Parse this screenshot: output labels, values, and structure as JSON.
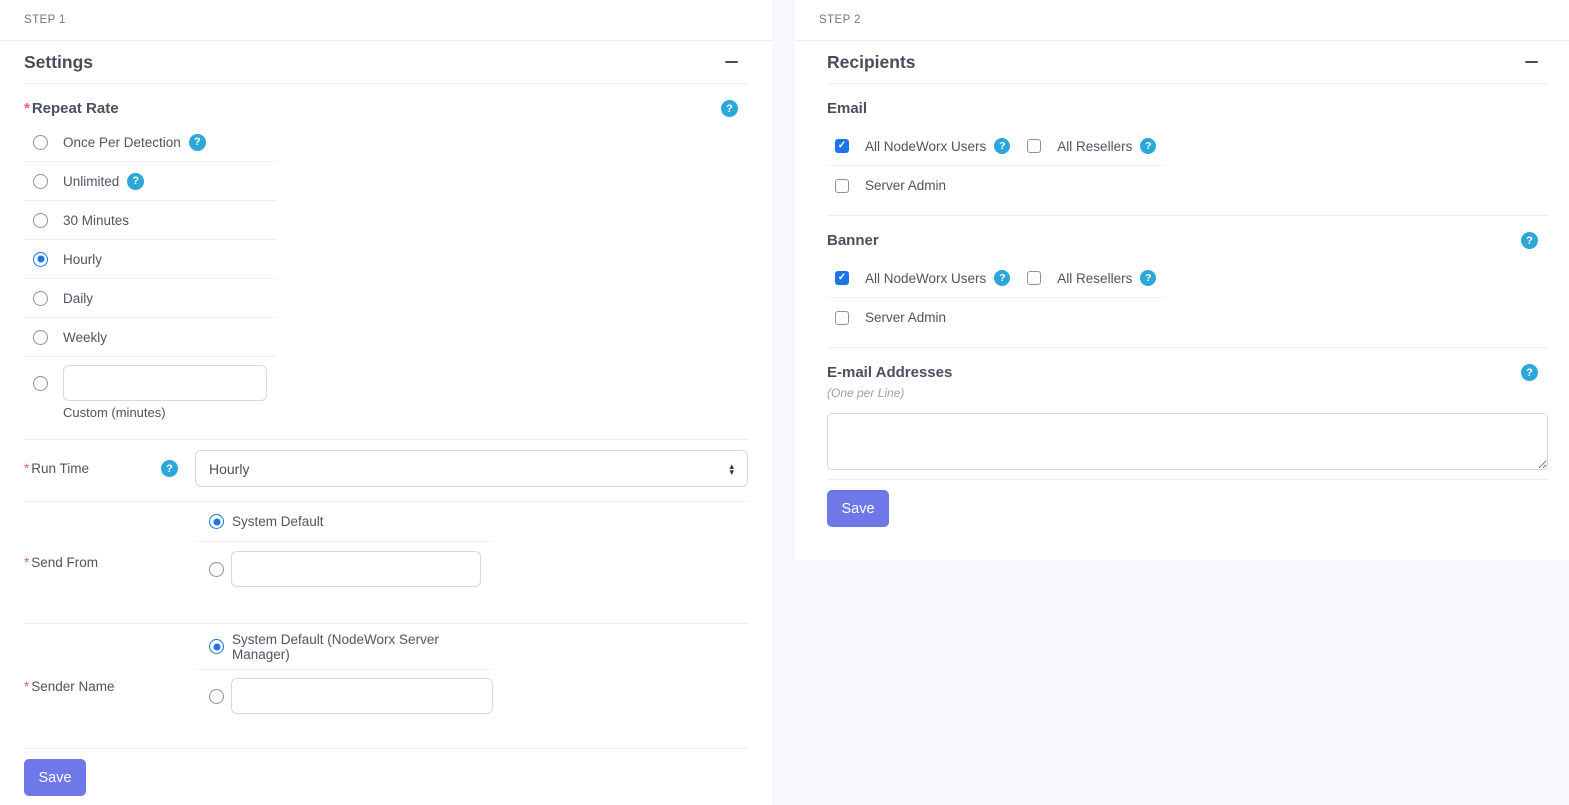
{
  "icons": {
    "help": "?",
    "check": "✓",
    "select_arrow_up": "▴",
    "select_arrow_down": "▾"
  },
  "colors": {
    "accent_blue": "#1b74e8",
    "help_blue": "#2ba7da",
    "save_indigo": "#6e78e8",
    "required_red": "#ee5a71",
    "page_background": "#f7f8fc"
  },
  "step1": {
    "step_label": "STEP 1",
    "title": "Settings",
    "repeat_rate": {
      "required_mark": "*",
      "label": "Repeat Rate",
      "options": [
        {
          "label": "Once Per Detection",
          "has_help": true,
          "selected": false
        },
        {
          "label": "Unlimited",
          "has_help": true,
          "selected": false
        },
        {
          "label": "30 Minutes",
          "has_help": false,
          "selected": false
        },
        {
          "label": "Hourly",
          "has_help": false,
          "selected": true
        },
        {
          "label": "Daily",
          "has_help": false,
          "selected": false
        },
        {
          "label": "Weekly",
          "has_help": false,
          "selected": false
        }
      ],
      "custom": {
        "label": "Custom (minutes)",
        "value": "",
        "selected": false
      }
    },
    "run_time": {
      "required_mark": "*",
      "label": "Run Time",
      "value": "Hourly"
    },
    "send_from": {
      "required_mark": "*",
      "label": "Send From",
      "system_option": {
        "label": "System Default",
        "selected": true
      },
      "custom_option": {
        "value": "",
        "selected": false
      }
    },
    "sender_name": {
      "required_mark": "*",
      "label": "Sender Name",
      "system_option": {
        "label": "System Default (NodeWorx Server Manager)",
        "selected": true
      },
      "custom_option": {
        "value": "",
        "selected": false
      }
    },
    "save_label": "Save"
  },
  "step2": {
    "step_label": "STEP 2",
    "title": "Recipients",
    "email": {
      "title": "Email",
      "all_users": {
        "label": "All NodeWorx Users",
        "checked": true,
        "has_help": true
      },
      "all_resellers": {
        "label": "All Resellers",
        "checked": false,
        "has_help": true
      },
      "server_admin": {
        "label": "Server Admin",
        "checked": false
      }
    },
    "banner": {
      "title": "Banner",
      "has_help": true,
      "all_users": {
        "label": "All NodeWorx Users",
        "checked": true,
        "has_help": true
      },
      "all_resellers": {
        "label": "All Resellers",
        "checked": false,
        "has_help": true
      },
      "server_admin": {
        "label": "Server Admin",
        "checked": false
      }
    },
    "email_addresses": {
      "title": "E-mail Addresses",
      "subtitle": "(One per Line)",
      "has_help": true,
      "value": ""
    },
    "save_label": "Save"
  }
}
